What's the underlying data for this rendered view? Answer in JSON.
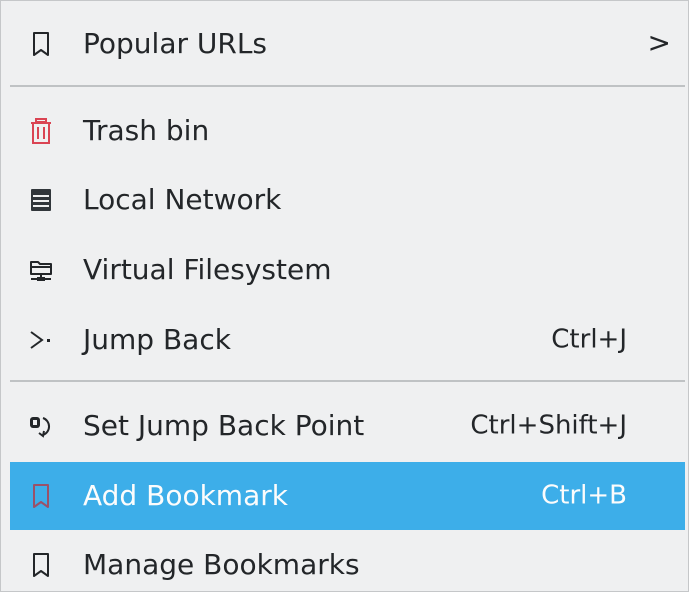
{
  "menu": {
    "items": [
      {
        "label": "Popular URLs",
        "icon": "bookmark-icon",
        "submenu": true
      },
      {
        "label": "Trash bin",
        "icon": "trash-icon"
      },
      {
        "label": "Local Network",
        "icon": "network-server-icon"
      },
      {
        "label": "Virtual Filesystem",
        "icon": "virtual-filesystem-icon"
      },
      {
        "label": "Jump Back",
        "icon": "jump-back-icon",
        "shortcut": "Ctrl+J"
      },
      {
        "label": "Set Jump Back Point",
        "icon": "set-jump-back-icon",
        "shortcut": "Ctrl+Shift+J"
      },
      {
        "label": "Add Bookmark",
        "icon": "bookmark-add-icon",
        "shortcut": "Ctrl+B",
        "highlighted": true
      },
      {
        "label": "Manage Bookmarks",
        "icon": "bookmark-manage-icon"
      }
    ],
    "submenu_arrow": ">"
  },
  "colors": {
    "highlight": "#3daee9",
    "menu_background": "#eff0f1",
    "text": "#232629",
    "trash_icon": "#da4453"
  }
}
